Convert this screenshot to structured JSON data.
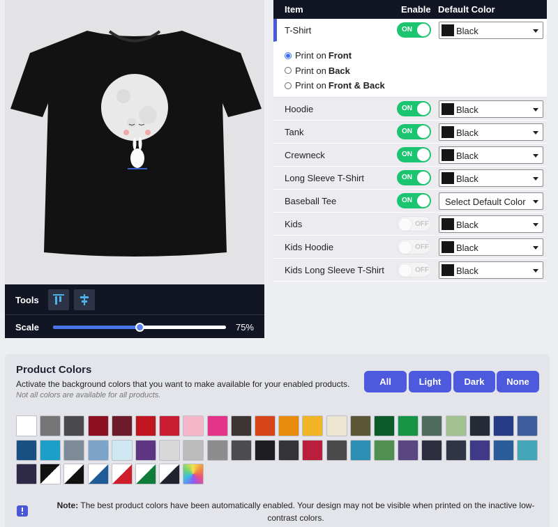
{
  "tools": {
    "tools_label": "Tools",
    "scale_label": "Scale",
    "scale_value": "75%",
    "scale_fraction": 0.75
  },
  "table": {
    "header_item": "Item",
    "header_enable": "Enable",
    "header_default_color": "Default Color",
    "rows": [
      {
        "name": "T-Shirt",
        "toggle": "ON",
        "color": "Black"
      },
      {
        "name": "Hoodie",
        "toggle": "ON",
        "color": "Black"
      },
      {
        "name": "Tank",
        "toggle": "ON",
        "color": "Black"
      },
      {
        "name": "Crewneck",
        "toggle": "ON",
        "color": "Black"
      },
      {
        "name": "Long Sleeve T-Shirt",
        "toggle": "ON",
        "color": "Black"
      },
      {
        "name": "Baseball Tee",
        "toggle": "ON",
        "color": "Select Default Color"
      },
      {
        "name": "Kids",
        "toggle": "OFF",
        "color": "Black"
      },
      {
        "name": "Kids Hoodie",
        "toggle": "OFF",
        "color": "Black"
      },
      {
        "name": "Kids Long Sleeve T-Shirt",
        "toggle": "OFF",
        "color": "Black"
      }
    ],
    "print_options": [
      {
        "prefix": "Print on",
        "bold": "Front"
      },
      {
        "prefix": "Print on",
        "bold": "Back"
      },
      {
        "prefix": "Print on",
        "bold": "Front & Back"
      }
    ]
  },
  "colors": {
    "title": "Product Colors",
    "description": "Activate the background colors that you want to make available for your enabled products.",
    "note": "Not all colors are available for all products.",
    "filters": [
      "All",
      "Light",
      "Dark",
      "None"
    ],
    "bottom_note_bold": "Note:",
    "bottom_note": "The best product colors have been automatically enabled. Your design may not be visible when printed on the inactive low-contrast colors.",
    "swatch_colors": [
      "#ffffff",
      "#767676",
      "#4a4a4c",
      "#8d1020",
      "#6d1a2a",
      "#c0141e",
      "#c81c32",
      "#f4b6c8",
      "#e4338a",
      "#3d3534",
      "#d6451a",
      "#e88a0e",
      "#f2b528",
      "#ece5cf",
      "#5d5638",
      "#0c5c2a",
      "#179446",
      "#4e6b5d",
      "#a3c190",
      "#262b38",
      "#273a86",
      "#3d5d9d",
      "#195081",
      "#1b9fc9",
      "#7d8b99",
      "#7ca4c8",
      "#cfe7f3",
      "#5e3483",
      "#d8d8d8",
      "#bcbcbc",
      "#8d8d8d",
      "#4c4c4f",
      "#1e1e22",
      "#333338",
      "#b91f3c",
      "#4a4a4a",
      "#2d8fb3",
      "#4f8f50",
      "#5a4781",
      "#2c2d3f",
      "#2f3545",
      "#3f3988",
      "#2a5c9a",
      "#43a7b9",
      "#2e2946"
    ]
  }
}
